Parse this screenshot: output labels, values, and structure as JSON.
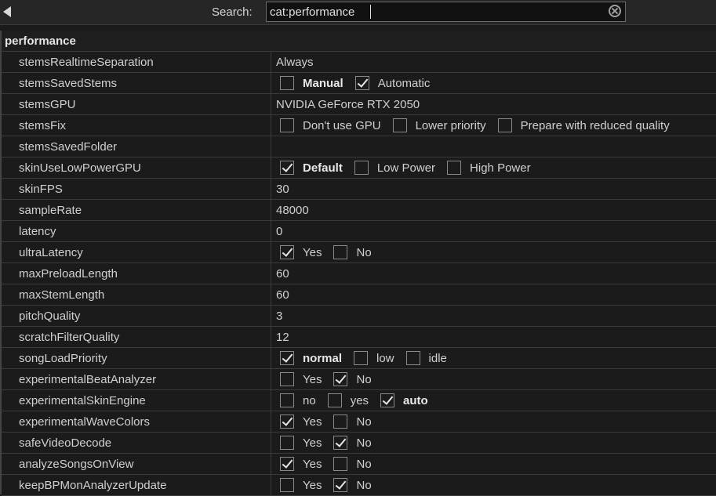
{
  "search": {
    "label": "Search:",
    "value": "cat:performance"
  },
  "section": {
    "title": "performance"
  },
  "rows": [
    {
      "name": "stemsRealtimeSeparation",
      "value": "Always"
    },
    {
      "name": "stemsSavedStems",
      "options": [
        {
          "label": "Manual",
          "checked": false,
          "bold": true
        },
        {
          "label": "Automatic",
          "checked": true,
          "bold": false
        }
      ]
    },
    {
      "name": "stemsGPU",
      "value": "NVIDIA GeForce RTX 2050"
    },
    {
      "name": "stemsFix",
      "options": [
        {
          "label": "Don't use GPU",
          "checked": false,
          "bold": false
        },
        {
          "label": "Lower priority",
          "checked": false,
          "bold": false
        },
        {
          "label": "Prepare with reduced quality",
          "checked": false,
          "bold": false
        }
      ]
    },
    {
      "name": "stemsSavedFolder",
      "value": ""
    },
    {
      "name": "skinUseLowPowerGPU",
      "options": [
        {
          "label": "Default",
          "checked": true,
          "bold": true
        },
        {
          "label": "Low Power",
          "checked": false,
          "bold": false
        },
        {
          "label": "High Power",
          "checked": false,
          "bold": false
        }
      ]
    },
    {
      "name": "skinFPS",
      "value": "30"
    },
    {
      "name": "sampleRate",
      "value": "48000"
    },
    {
      "name": "latency",
      "value": "0"
    },
    {
      "name": "ultraLatency",
      "options": [
        {
          "label": "Yes",
          "checked": true,
          "bold": false
        },
        {
          "label": "No",
          "checked": false,
          "bold": false
        }
      ]
    },
    {
      "name": "maxPreloadLength",
      "value": "60"
    },
    {
      "name": "maxStemLength",
      "value": "60"
    },
    {
      "name": "pitchQuality",
      "value": "3"
    },
    {
      "name": "scratchFilterQuality",
      "value": "12"
    },
    {
      "name": "songLoadPriority",
      "options": [
        {
          "label": "normal",
          "checked": true,
          "bold": true
        },
        {
          "label": "low",
          "checked": false,
          "bold": false
        },
        {
          "label": "idle",
          "checked": false,
          "bold": false
        }
      ]
    },
    {
      "name": "experimentalBeatAnalyzer",
      "options": [
        {
          "label": "Yes",
          "checked": false,
          "bold": false
        },
        {
          "label": "No",
          "checked": true,
          "bold": false
        }
      ]
    },
    {
      "name": "experimentalSkinEngine",
      "options": [
        {
          "label": "no",
          "checked": false,
          "bold": false
        },
        {
          "label": "yes",
          "checked": false,
          "bold": false
        },
        {
          "label": "auto",
          "checked": true,
          "bold": true
        }
      ]
    },
    {
      "name": "experimentalWaveColors",
      "options": [
        {
          "label": "Yes",
          "checked": true,
          "bold": false
        },
        {
          "label": "No",
          "checked": false,
          "bold": false
        }
      ]
    },
    {
      "name": "safeVideoDecode",
      "options": [
        {
          "label": "Yes",
          "checked": false,
          "bold": false
        },
        {
          "label": "No",
          "checked": true,
          "bold": false
        }
      ]
    },
    {
      "name": "analyzeSongsOnView",
      "options": [
        {
          "label": "Yes",
          "checked": true,
          "bold": false
        },
        {
          "label": "No",
          "checked": false,
          "bold": false
        }
      ]
    },
    {
      "name": "keepBPMonAnalyzerUpdate",
      "options": [
        {
          "label": "Yes",
          "checked": false,
          "bold": false
        },
        {
          "label": "No",
          "checked": true,
          "bold": false
        }
      ]
    }
  ]
}
